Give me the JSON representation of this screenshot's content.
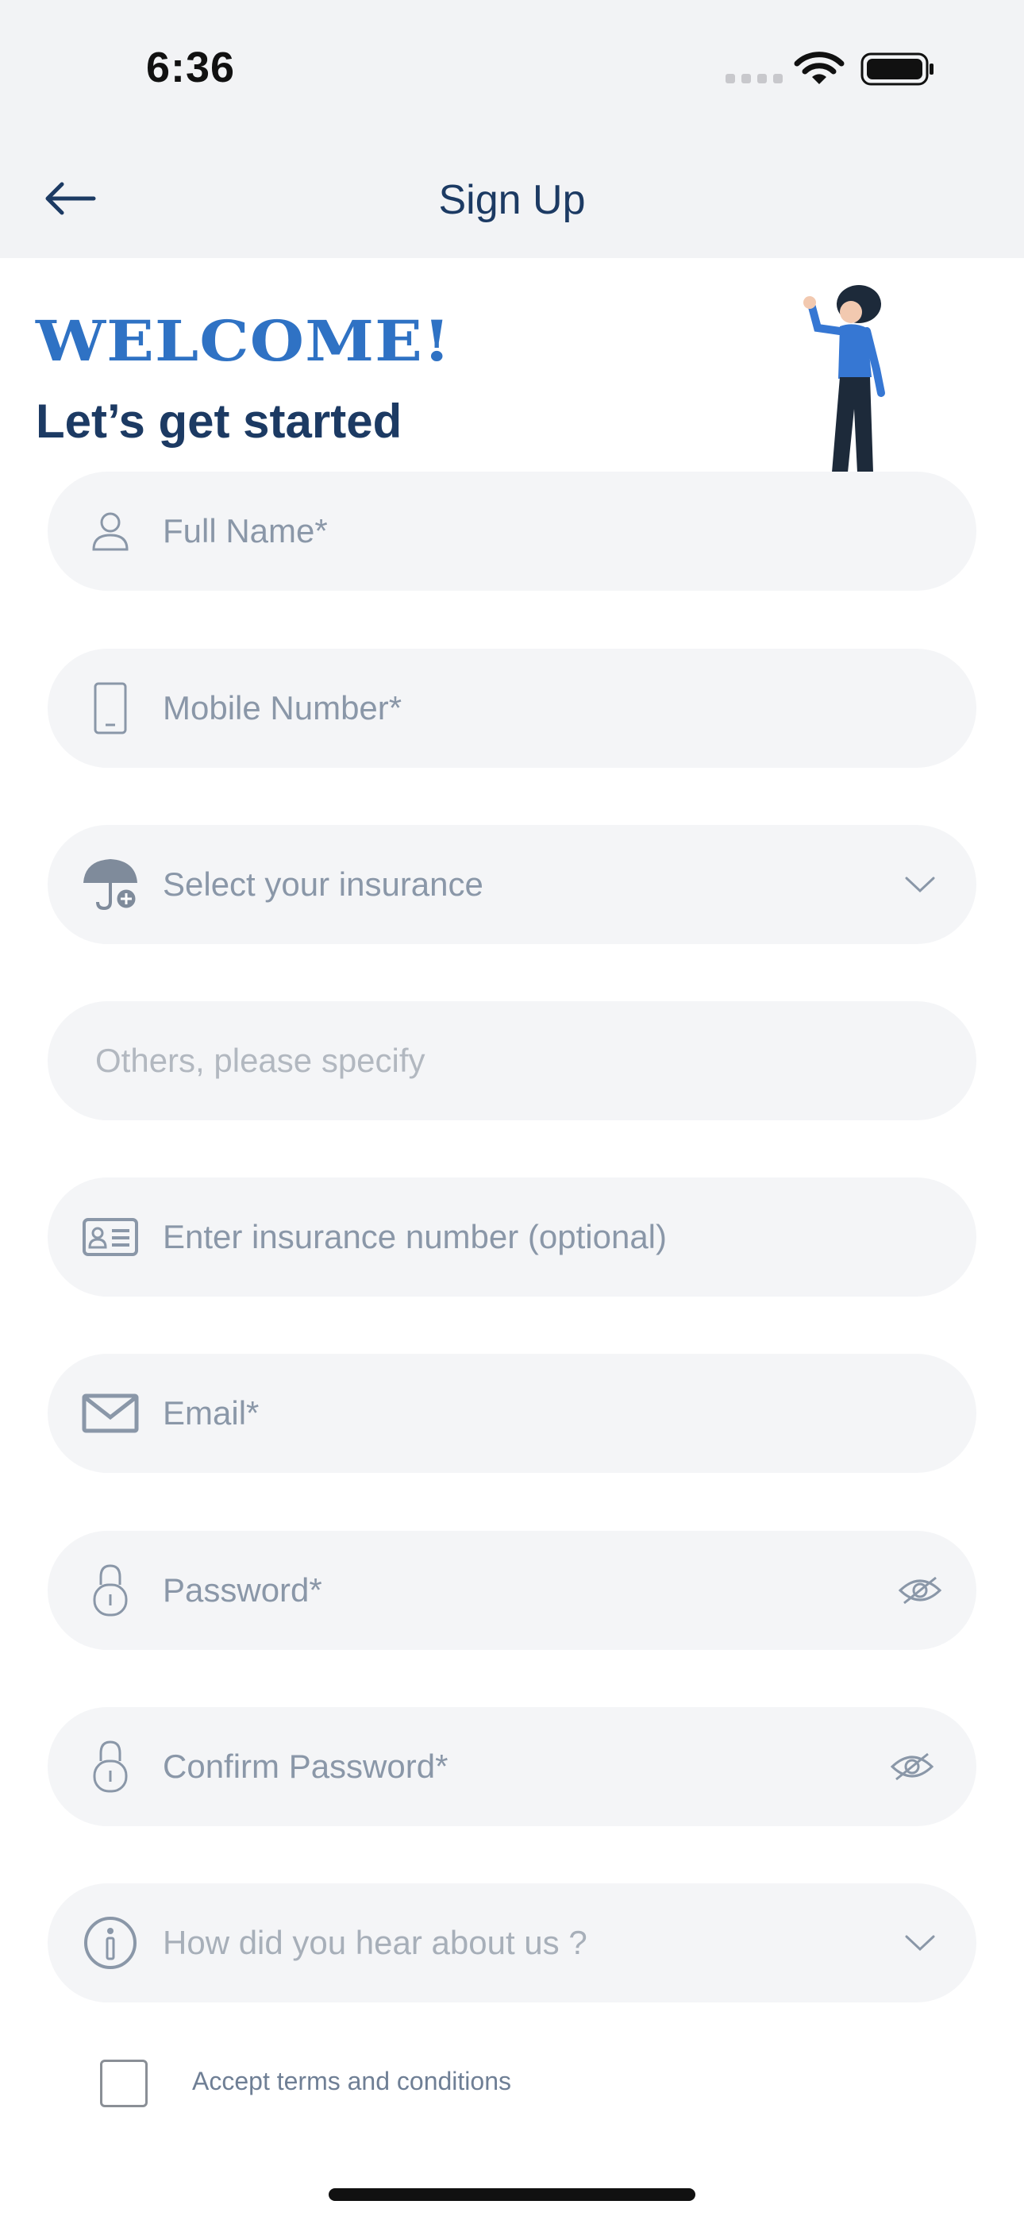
{
  "status_bar": {
    "time": "6:36"
  },
  "header": {
    "title": "Sign Up"
  },
  "welcome": {
    "heading": "WELCOME!",
    "subheading": "Let’s get started"
  },
  "form": {
    "full_name_placeholder": "Full Name*",
    "mobile_placeholder": "Mobile Number*",
    "insurance_select_placeholder": "Select your insurance",
    "others_placeholder": "Others, please specify",
    "insurance_number_placeholder": "Enter insurance number (optional)",
    "email_placeholder": "Email*",
    "password_placeholder": "Password*",
    "confirm_password_placeholder": "Confirm Password*",
    "hear_about_placeholder": "How did you hear about us ?",
    "terms_label": "Accept terms and conditions",
    "terms_checked": false
  },
  "colors": {
    "accent": "#2f72c4",
    "title": "#1c3a63",
    "field_bg": "#f4f5f7",
    "placeholder": "#8a97a8",
    "icon": "#8a97a8"
  },
  "icons": [
    "back-arrow-icon",
    "user-icon",
    "mobile-icon",
    "umbrella-icon",
    "chevron-down-icon",
    "id-card-icon",
    "mail-icon",
    "lock-icon",
    "eye-off-icon",
    "info-icon"
  ]
}
